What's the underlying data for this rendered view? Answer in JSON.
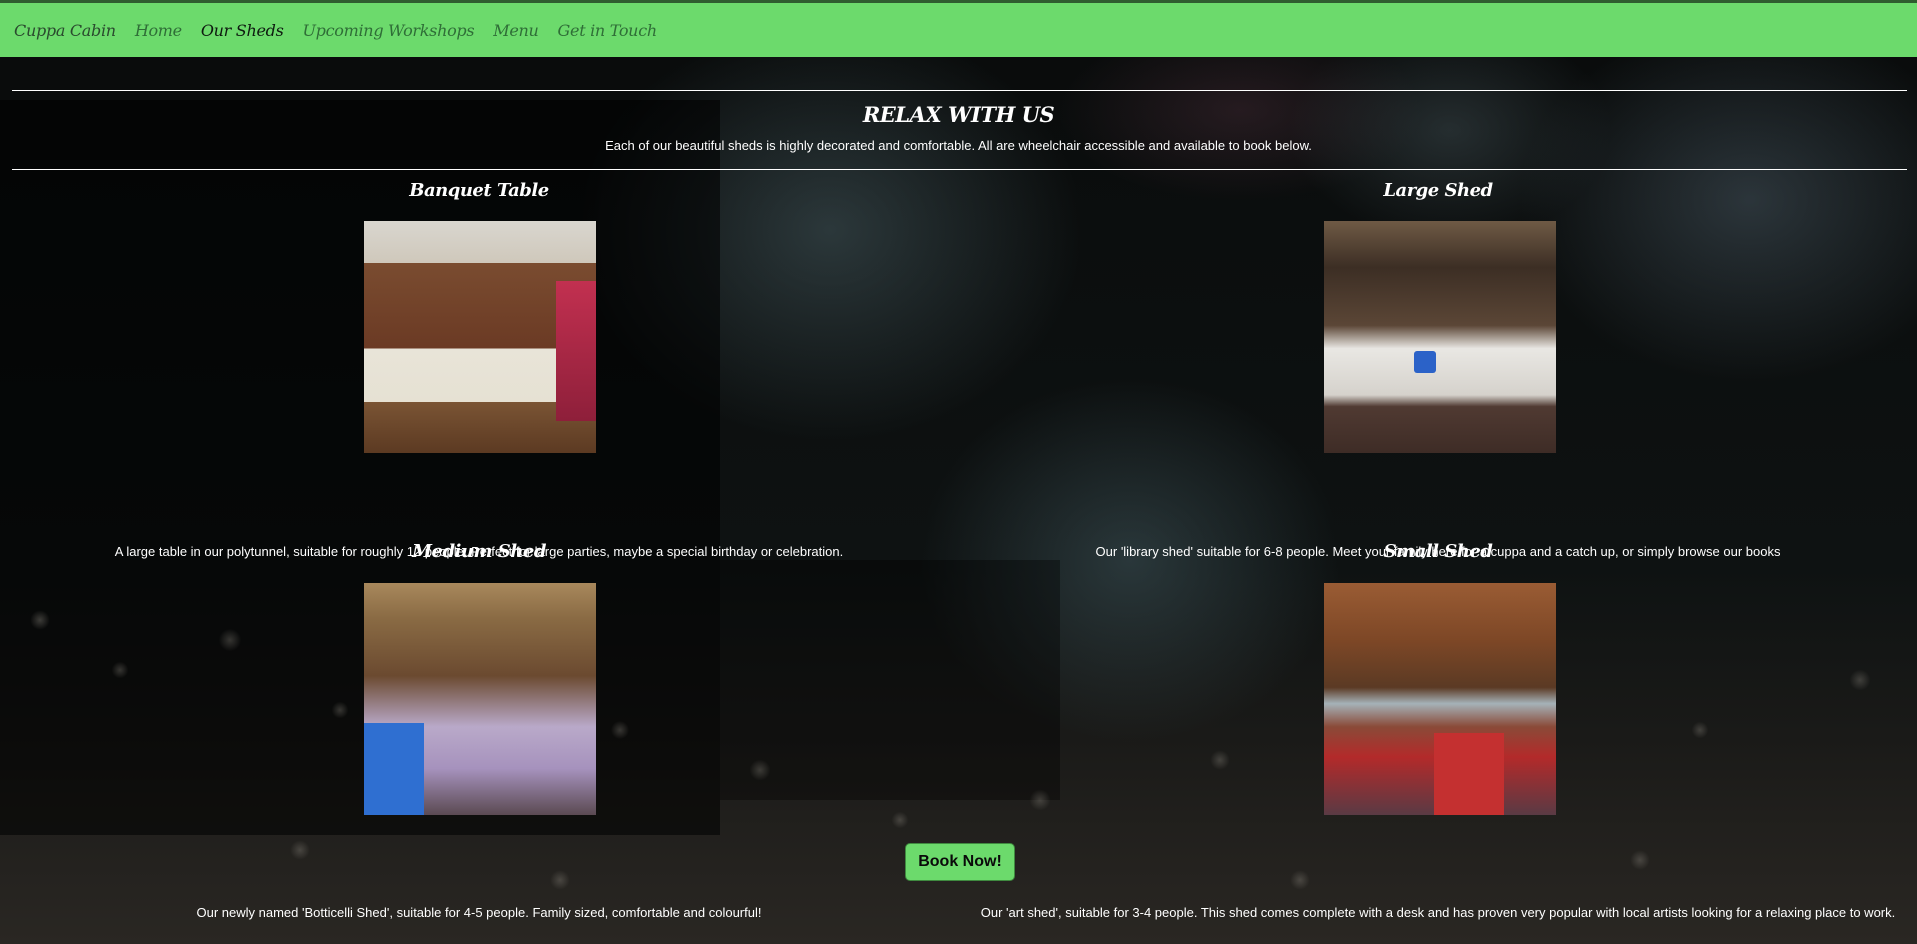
{
  "nav": {
    "brand": "Cuppa Cabin",
    "links": [
      "Home",
      "Our Sheds",
      "Upcoming Workshops",
      "Menu",
      "Get in Touch"
    ],
    "active": "Our Sheds"
  },
  "hero": {
    "title": "RELAX WITH US",
    "subtitle": "Each of our beautiful sheds is highly decorated and comfortable. All are wheelchair accessible and available to book below."
  },
  "sheds": [
    {
      "title": "Banquet Table",
      "description": "A large table in our polytunnel, suitable for roughly 12 people. Perfect for large parties, maybe a special birthday or celebration."
    },
    {
      "title": "Large Shed",
      "description": "Our 'library shed' suitable for 6-8 people. Meet your family here for a cuppa and a catch up, or simply browse our books"
    },
    {
      "title": "Medium Shed",
      "description": "Our newly named 'Botticelli Shed', suitable for 4-5 people. Family sized, comfortable and colourful!"
    },
    {
      "title": "Small Shed",
      "description": "Our 'art shed', suitable for 3-4 people. This shed comes complete with a desk and has proven very popular with local artists looking for a relaxing place to work."
    }
  ],
  "cta": {
    "label": "Book Now!"
  },
  "colors": {
    "nav_bg": "#6cda6c",
    "button_bg": "#6cda6c",
    "text": "#ffffff"
  }
}
